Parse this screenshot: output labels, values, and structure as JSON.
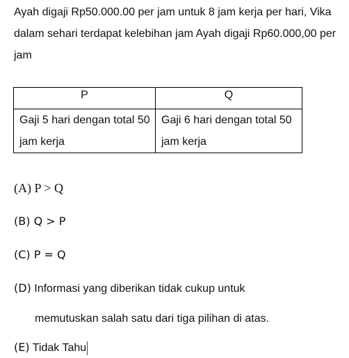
{
  "problem": {
    "text": "Ayah digaji Rp50.000.00 per jam untuk 8 jam kerja per hari, Vika dalam sehari terdapat kelebihan jam Ayah digaji Rp60.000,00 per jam"
  },
  "table": {
    "headers": [
      "P",
      "Q"
    ],
    "rows": [
      [
        "Gaji 5 hari dengan total 50 jam kerja",
        "Gaji 6 hari dengan total 50 jam kerja"
      ]
    ]
  },
  "options": [
    {
      "letter": "(A)",
      "text": "P > Q"
    },
    {
      "letter": "(B)",
      "text": "Q > P"
    },
    {
      "letter": "(C)",
      "text": "P = Q"
    },
    {
      "letter": "(D)",
      "text": "Informasi yang diberikan tidak cukup untuk",
      "continuation": "memutuskan salah satu dari tiga pilihan di atas."
    },
    {
      "letter": "(E)",
      "text": "Tidak Tahu"
    }
  ]
}
